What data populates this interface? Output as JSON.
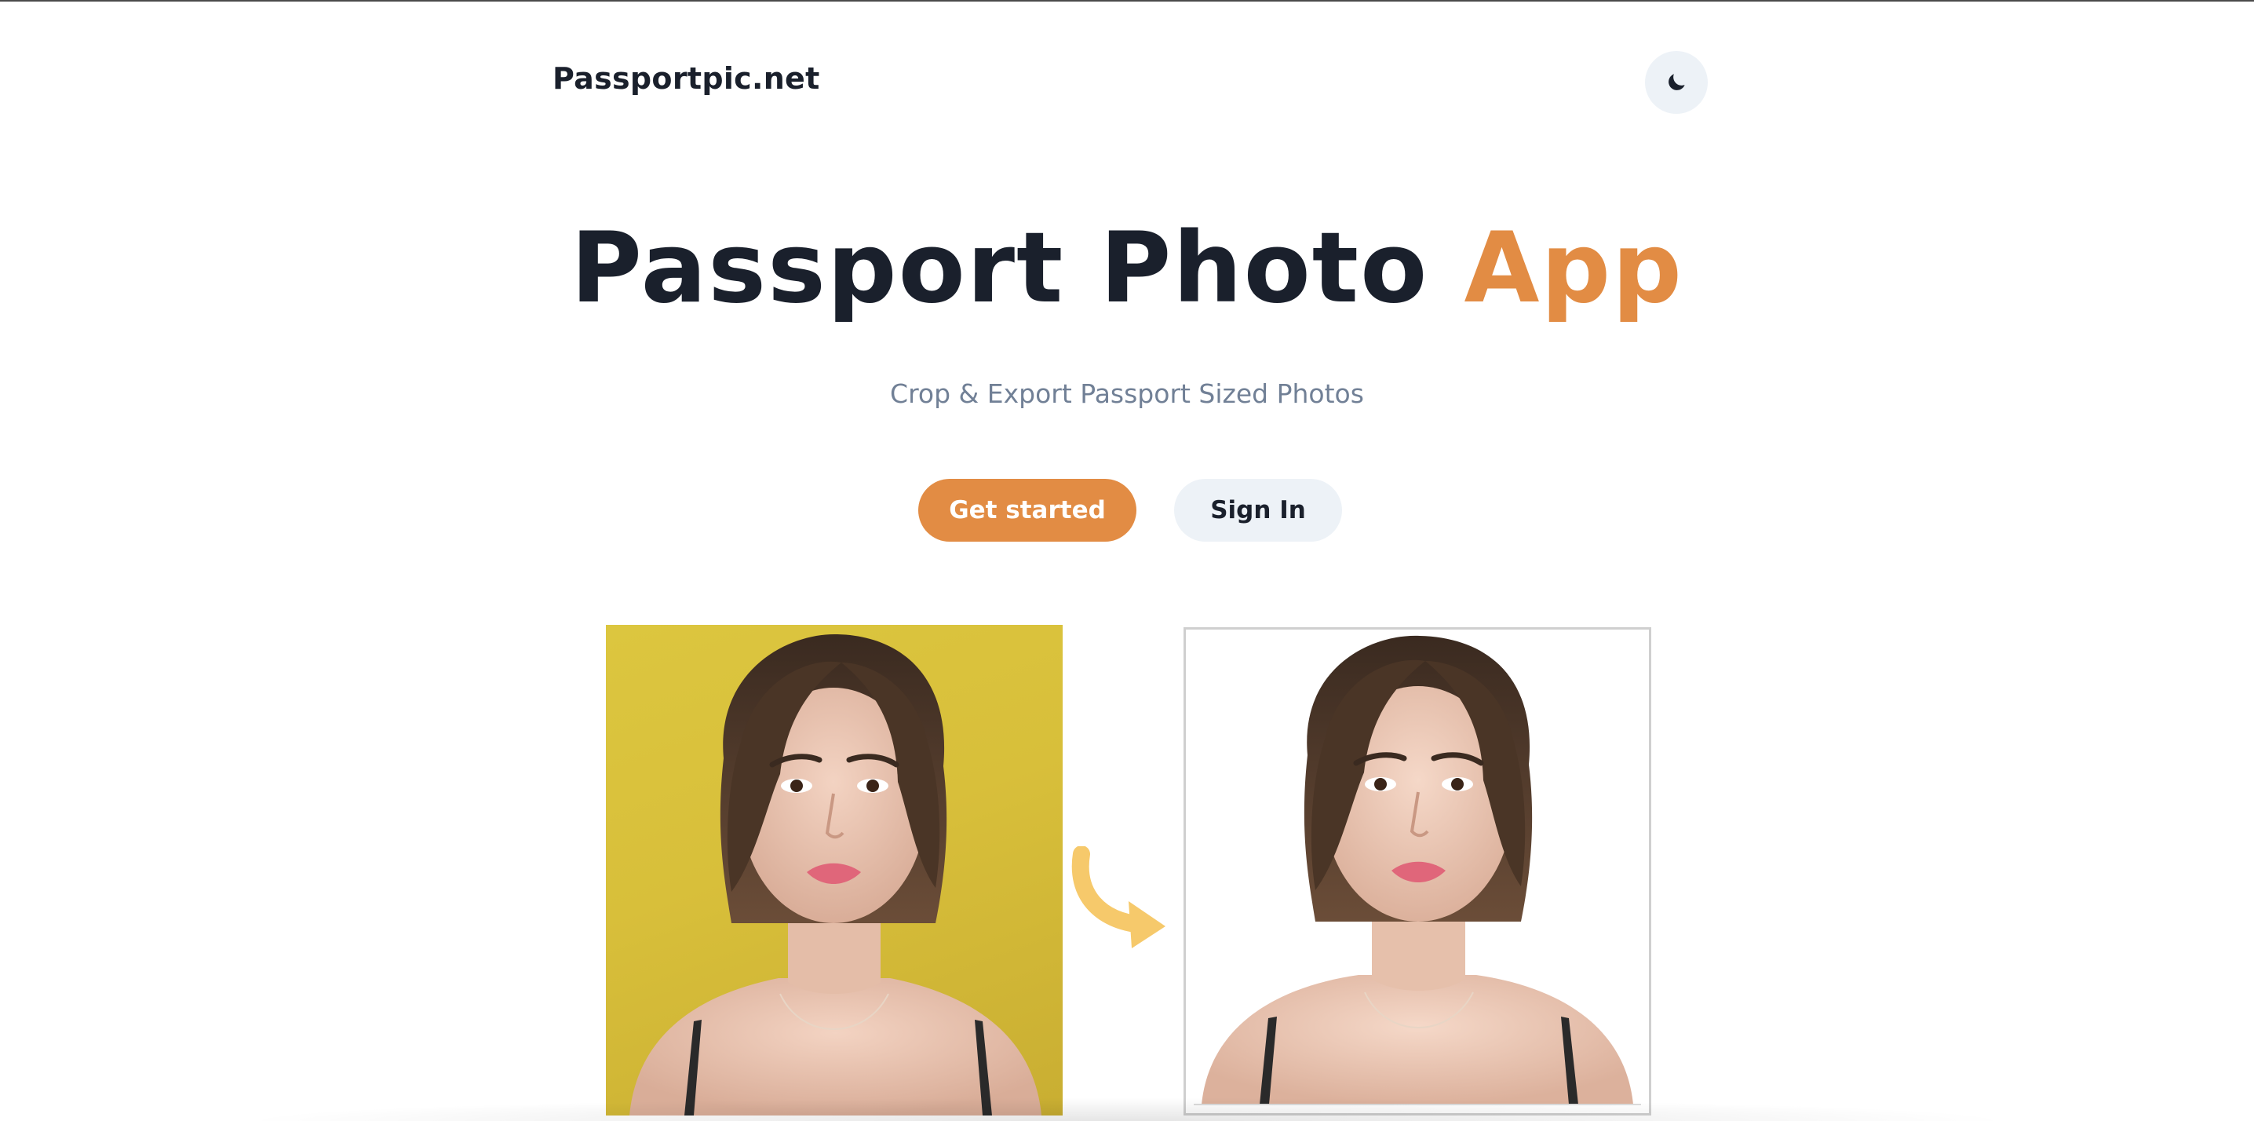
{
  "header": {
    "brand": "Passportpic.net",
    "theme_toggle_icon": "moon-icon"
  },
  "hero": {
    "title_main": "Passport Photo",
    "title_accent": "App",
    "subtitle": "Crop & Export Passport Sized Photos"
  },
  "actions": {
    "primary_label": "Get started",
    "secondary_label": "Sign In"
  },
  "demo": {
    "before_image": "original-portrait-yellow-background",
    "arrow_icon": "curved-arrow-right-icon",
    "after_image": "passport-portrait-white-background"
  },
  "colors": {
    "accent": "#e28c44",
    "heading": "#1a202c",
    "muted": "#718096",
    "button_secondary_bg": "#edf2f7",
    "arrow": "#f6c96b",
    "before_bg": "#d8bf3a"
  }
}
